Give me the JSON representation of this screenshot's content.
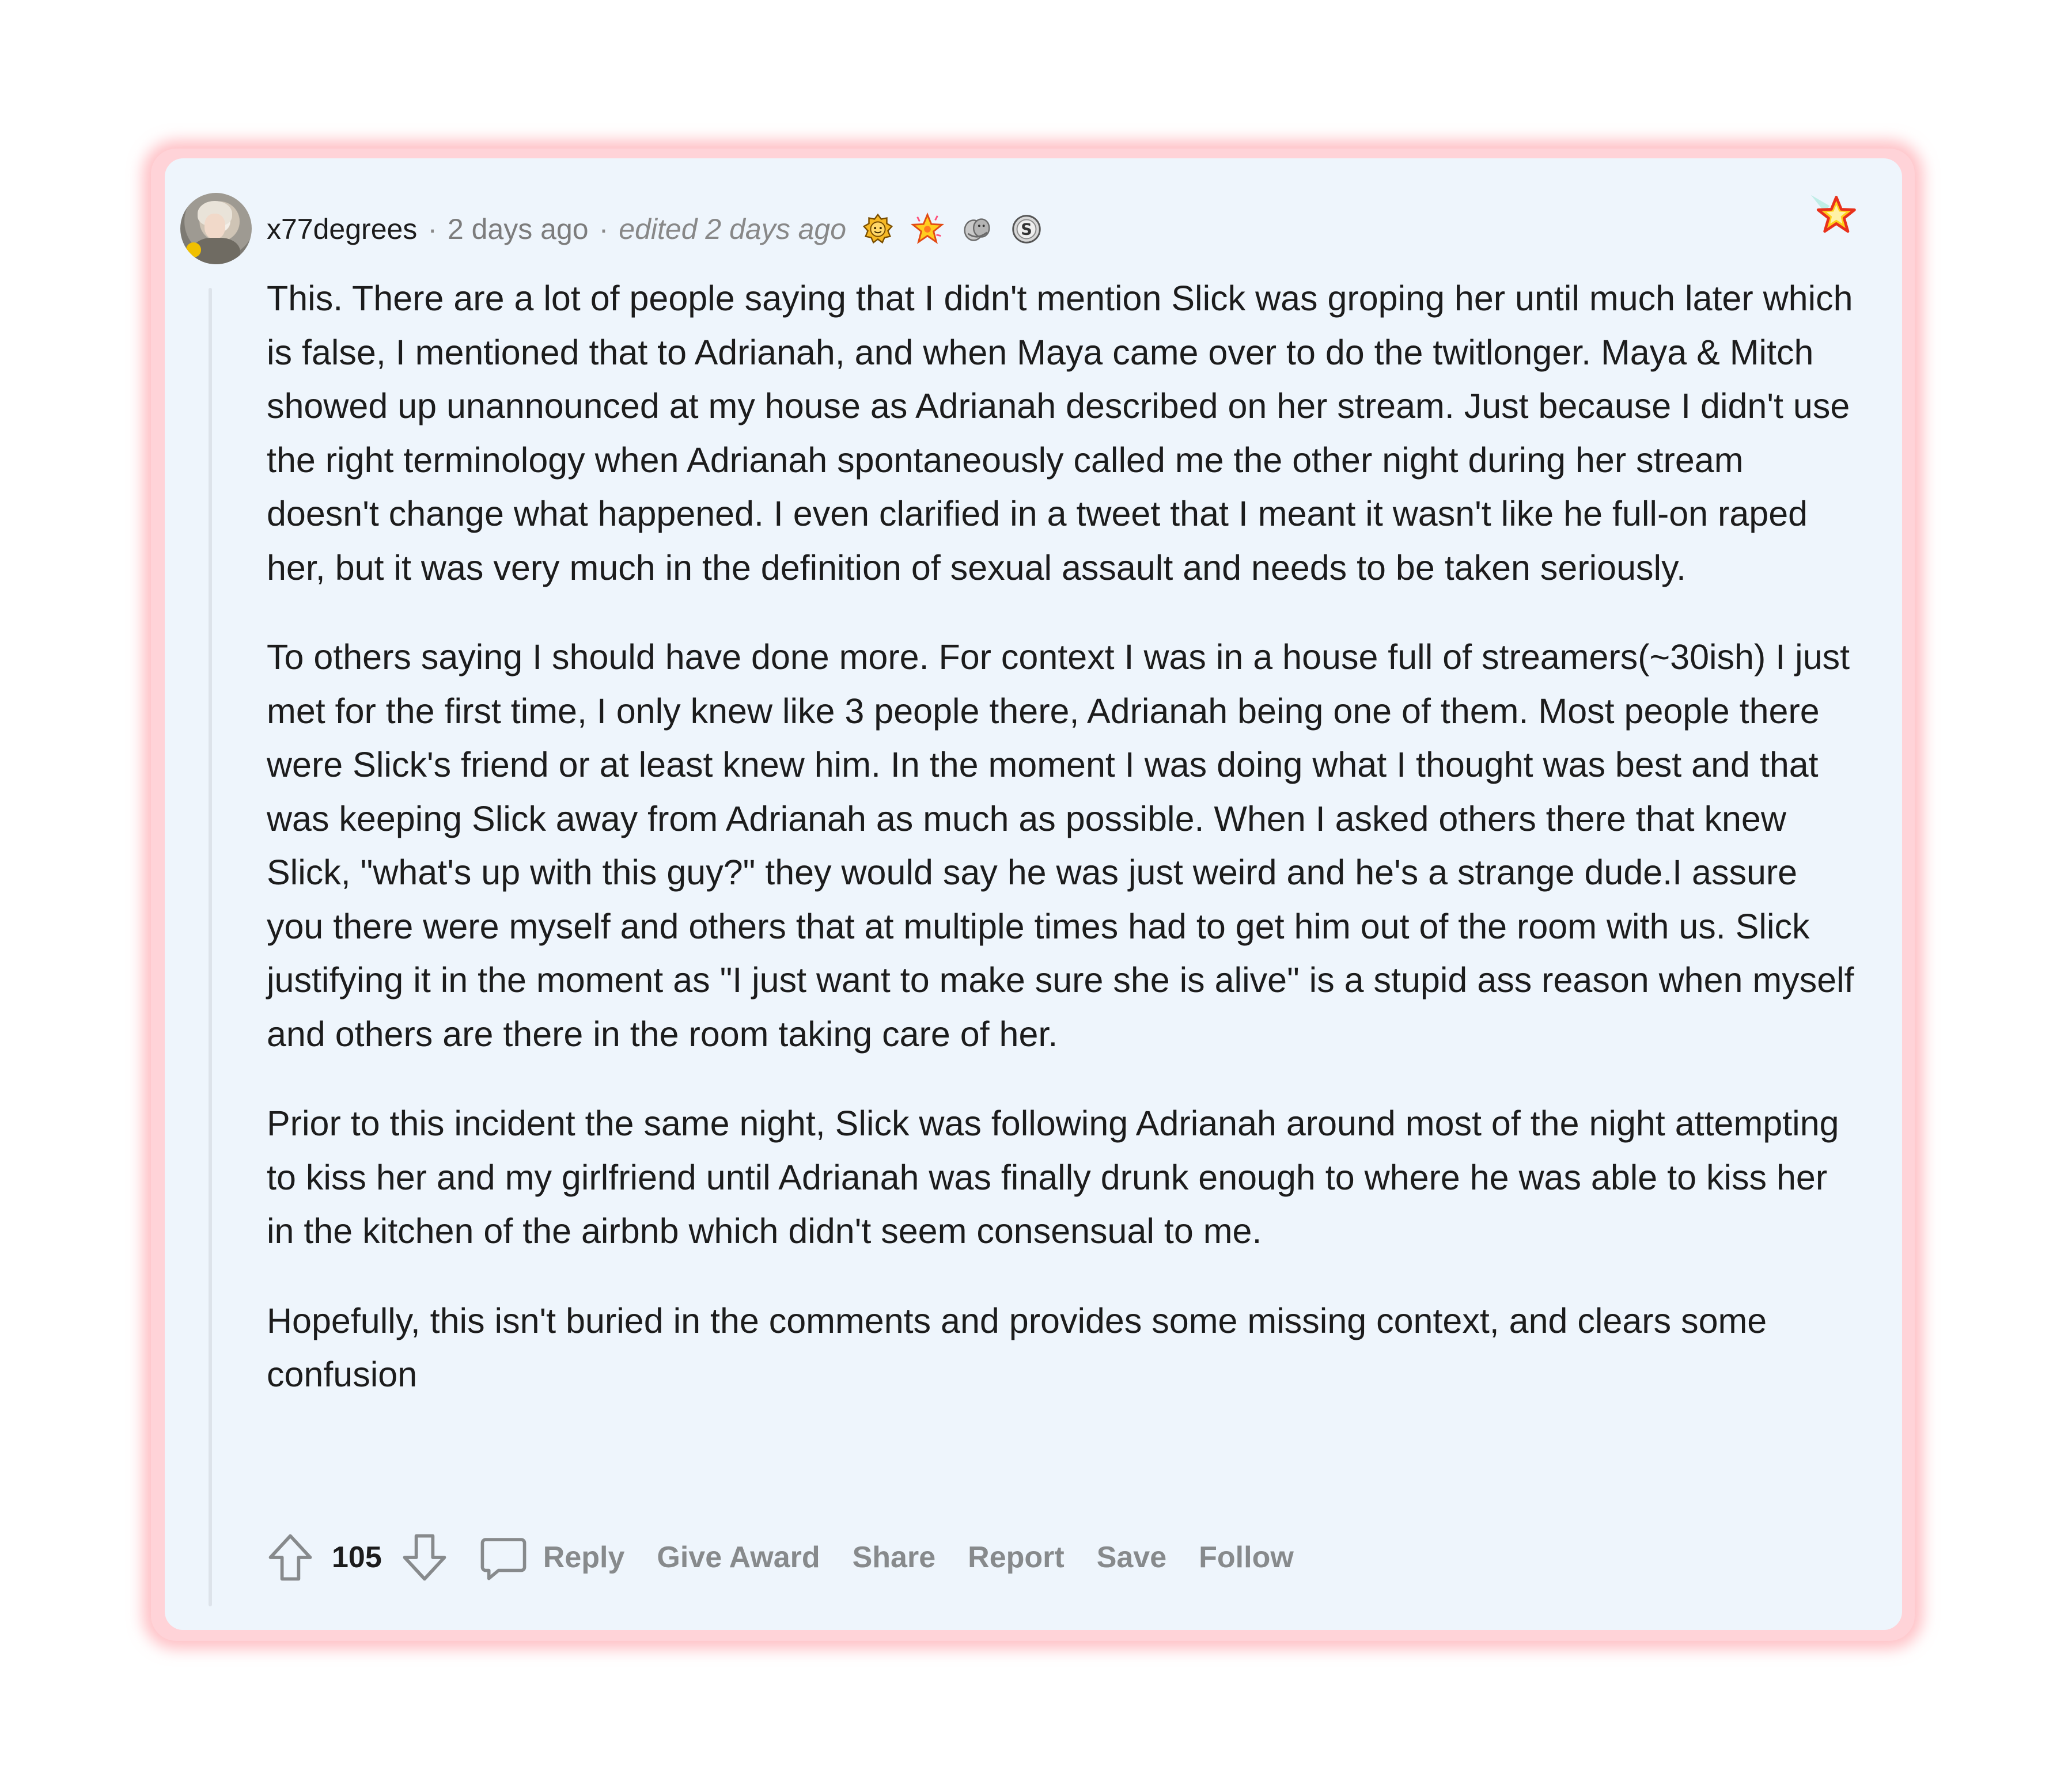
{
  "comment": {
    "username": "x77degrees",
    "timestamp": "2 days ago",
    "edited": "edited 2 days ago",
    "separator": "·",
    "awards": [
      "wholesome-seal-award-icon",
      "starstruck-award-icon",
      "hugz-award-icon",
      "silver-award-icon"
    ],
    "top_award": "rocket-star-award-icon",
    "paragraphs": [
      "This. There are a lot of people saying that I didn't mention Slick was groping her until much later which is false, I mentioned that to Adrianah, and when Maya came over to do the twitlonger. Maya & Mitch showed up unannounced at my house as Adrianah described on her stream. Just because I didn't use the right terminology when Adrianah spontaneously called me the other night during her stream doesn't change what happened. I even clarified in a tweet that I meant it wasn't like he full-on raped her, but it was very much in the definition of sexual assault and needs to be taken seriously.",
      "To others saying I should have done more. For context I was in a house full of streamers(~30ish) I just met for the first time, I only knew like 3 people there, Adrianah being one of them. Most people there were Slick's friend or at least knew him. In the moment I was doing what I thought was best and that was keeping Slick away from Adrianah as much as possible. When I asked others there that knew Slick, \"what's up with this guy?\" they would say he was just weird and he's a strange dude.I assure you there were myself and others that at multiple times had to get him out of the room with us. Slick justifying it in the moment as \"I just want to make sure she is alive\" is a stupid ass reason when myself and others are there in the room taking care of her.",
      "Prior to this incident the same night, Slick was following Adrianah around most of the night attempting to kiss her and my girlfriend until Adrianah was finally drunk enough to where he was able to kiss her in the kitchen of the airbnb which didn't seem consensual to me.",
      "Hopefully, this isn't buried in the comments and provides some missing context, and clears some confusion"
    ],
    "actions": {
      "score": "105",
      "reply": "Reply",
      "give_award": "Give Award",
      "share": "Share",
      "report": "Report",
      "save": "Save",
      "follow": "Follow"
    }
  },
  "colors": {
    "card_background": "#eef5fc",
    "highlight_frame": "#ffb3bb",
    "text": "#1c1c1c",
    "meta": "#7c7c7c",
    "action": "#878a8c"
  }
}
